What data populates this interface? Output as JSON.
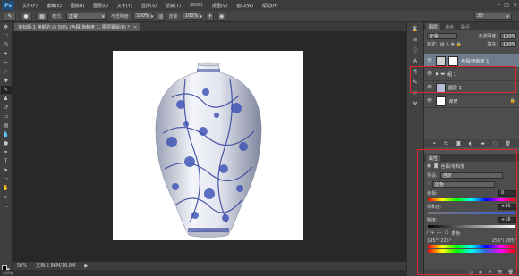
{
  "app": {
    "logo": "Ps"
  },
  "menu": [
    "文件(F)",
    "编辑(E)",
    "图像(I)",
    "图层(L)",
    "文字(Y)",
    "选择(S)",
    "滤镜(T)",
    "3D(D)",
    "视图(V)",
    "窗口(W)",
    "帮助(H)"
  ],
  "options": {
    "mode_label": "模式:",
    "mode_value": "正常",
    "opacity_label": "不透明度:",
    "opacity_value": "100%",
    "flow_label": "流量:",
    "flow_value": "100%",
    "workspace": "3D"
  },
  "document_tab": {
    "title": "未标题-1 换颜的 @ 50% (色相/饱和度 1, 图层蒙版/8) *",
    "close": "×"
  },
  "status": {
    "zoom": "50%",
    "doc": "文档:2.86M/16.8M"
  },
  "mini_tab": "时间轴",
  "layers_panel": {
    "tabs": [
      "图层",
      "通道",
      "路径"
    ],
    "blend": "正常",
    "opacity_label": "不透明度:",
    "opacity": "100%",
    "lock_label": "锁定:",
    "fill_label": "填充:",
    "fill": "100%",
    "layers": [
      {
        "name": "色相/饱和度 1",
        "selected": true
      },
      {
        "name": "组 1",
        "selected": false
      },
      {
        "name": "图层 1",
        "selected": false
      },
      {
        "name": "背景",
        "selected": false
      }
    ]
  },
  "properties_panel": {
    "tabs": [
      "属性"
    ],
    "title": "色相/饱和度",
    "preset_label": "预设:",
    "preset": "自定",
    "channel": "蓝色",
    "hue_label": "色相:",
    "hue": "0",
    "sat_label": "饱和度:",
    "sat": "+30",
    "light_label": "明度:",
    "light": "+16",
    "colorize_label": "着色",
    "range_left": "195°/ 225°",
    "range_right": "255°\\ 285°"
  }
}
